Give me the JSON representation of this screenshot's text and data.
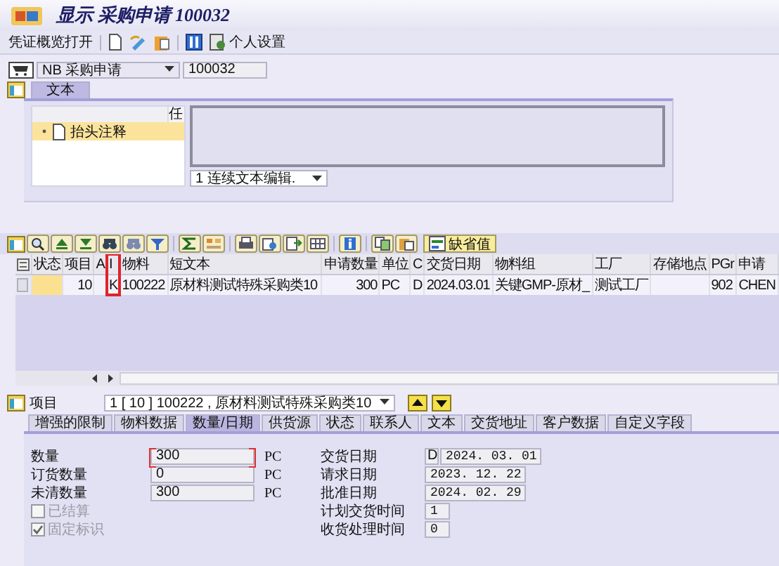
{
  "window": {
    "title": "显示 采购申请 100032"
  },
  "toolbar": {
    "overview_button": "凭证概览打开",
    "settings_button": "个人设置"
  },
  "header": {
    "document_type": "NB 采购申请",
    "number": "100032"
  },
  "header_tabs": [
    {
      "label": "文本",
      "selected": true
    }
  ],
  "texts": {
    "column_header": "任",
    "tree": [
      {
        "label": "抬头注释",
        "selected": true
      }
    ],
    "editor_mode": "1 连续文本编辑."
  },
  "items_toolbar": {
    "default_button": "缺省值"
  },
  "table": {
    "columns": [
      {
        "label": "状态",
        "kind": "status",
        "highlighted": false
      },
      {
        "label": "项目",
        "kind": "number",
        "highlighted": false
      },
      {
        "label": "A",
        "kind": "text",
        "highlighted": false
      },
      {
        "label": "I",
        "kind": "text",
        "highlighted": true
      },
      {
        "label": "物料",
        "kind": "text",
        "highlighted": false
      },
      {
        "label": "短文本",
        "kind": "text",
        "highlighted": false
      },
      {
        "label": "申请数量",
        "kind": "number",
        "highlighted": false
      },
      {
        "label": "单位",
        "kind": "text",
        "highlighted": false
      },
      {
        "label": "C",
        "kind": "text",
        "highlighted": false
      },
      {
        "label": "交货日期",
        "kind": "text",
        "highlighted": false
      },
      {
        "label": "物料组",
        "kind": "text",
        "highlighted": false
      },
      {
        "label": "工厂",
        "kind": "text",
        "highlighted": false
      },
      {
        "label": "存储地点",
        "kind": "text",
        "highlighted": false
      },
      {
        "label": "PGr",
        "kind": "text",
        "highlighted": false
      },
      {
        "label": "申请",
        "kind": "text",
        "highlighted": false
      }
    ],
    "rows": [
      {
        "cells": [
          null,
          "10",
          null,
          "K",
          "100222",
          "原材料测试特殊采购类10",
          "300",
          "PC",
          "D",
          "2024.03.01",
          "关键GMP-原材_",
          "测试工厂",
          null,
          "902",
          "CHEN"
        ]
      }
    ]
  },
  "item": {
    "label": "项目",
    "value": "1 [ 10 ] 100222 , 原材料测试特殊采购类10"
  },
  "item_tabs": [
    {
      "label": "增强的限制",
      "selected": false
    },
    {
      "label": "物料数据",
      "selected": false
    },
    {
      "label": "数量/日期",
      "selected": true
    },
    {
      "label": "供货源",
      "selected": false
    },
    {
      "label": "状态",
      "selected": false
    },
    {
      "label": "联系人",
      "selected": false
    },
    {
      "label": "文本",
      "selected": false
    },
    {
      "label": "交货地址",
      "selected": false
    },
    {
      "label": "客户数据",
      "selected": false
    },
    {
      "label": "自定义字段",
      "selected": false
    }
  ],
  "quantities": [
    {
      "label": "数量",
      "value": "300",
      "unit": "PC",
      "focused": true
    },
    {
      "label": "订货数量",
      "value": "0",
      "unit": "PC",
      "focused": false
    },
    {
      "label": "未清数量",
      "value": "300",
      "unit": "PC",
      "focused": false
    }
  ],
  "flags": [
    {
      "label": "已结算",
      "checked": false,
      "disabled": true
    },
    {
      "label": "固定标识",
      "checked": true,
      "disabled": true
    }
  ],
  "dates": [
    {
      "label": "交货日期",
      "kind": "date",
      "prefix": "D",
      "value": "2024. 03. 01"
    },
    {
      "label": "请求日期",
      "kind": "date",
      "value": "2023. 12. 22"
    },
    {
      "label": "批准日期",
      "kind": "date",
      "value": "2024. 02. 29"
    },
    {
      "label": "计划交货时间",
      "kind": "days",
      "value": "1"
    },
    {
      "label": "收货处理时间",
      "kind": "days",
      "value": "0"
    }
  ]
}
